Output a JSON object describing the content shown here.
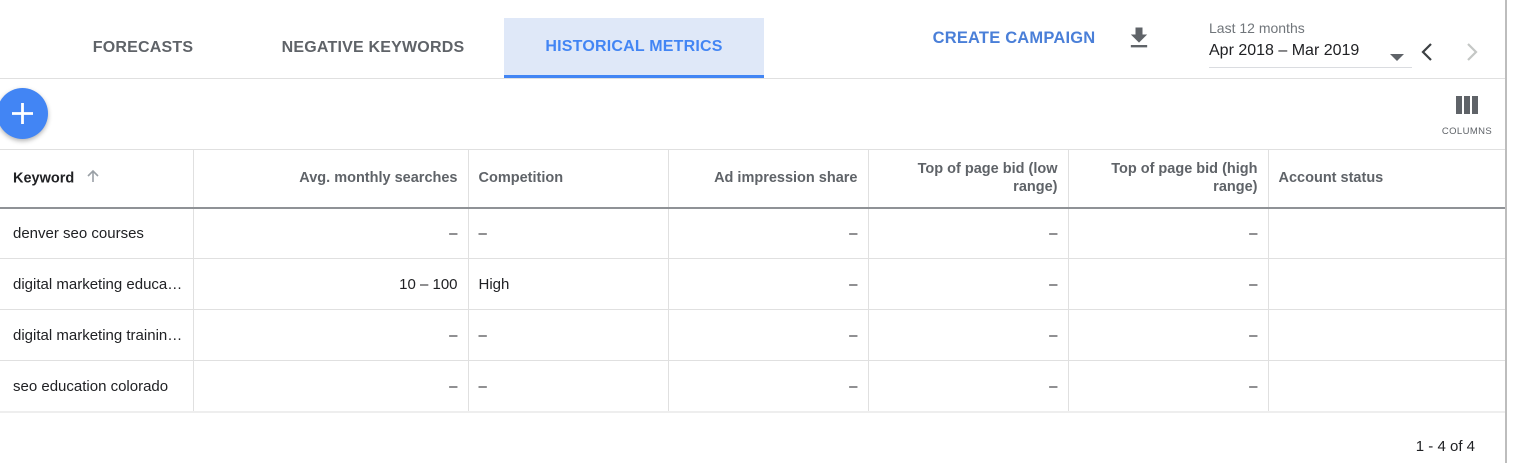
{
  "tabs": [
    {
      "label": "FORECASTS"
    },
    {
      "label": "NEGATIVE KEYWORDS"
    },
    {
      "label": "HISTORICAL METRICS",
      "active": true
    }
  ],
  "toolbar": {
    "create_campaign_label": "CREATE CAMPAIGN",
    "download_icon": "download-icon",
    "date_range_label": "Last 12 months",
    "date_range_value": "Apr 2018 – Mar 2019"
  },
  "actions": {
    "add_icon": "plus-icon",
    "columns_label": "COLUMNS"
  },
  "table": {
    "columns": [
      "Keyword",
      "Avg. monthly searches",
      "Competition",
      "Ad impression share",
      "Top of page bid (low range)",
      "Top of page bid (high range)",
      "Account status"
    ],
    "rows": [
      [
        "denver seo courses",
        "–",
        "–",
        "–",
        "–",
        "–",
        ""
      ],
      [
        "digital marketing educa…",
        "10 – 100",
        "High",
        "–",
        "–",
        "–",
        ""
      ],
      [
        "digital marketing trainin…",
        "–",
        "–",
        "–",
        "–",
        "–",
        ""
      ],
      [
        "seo education colorado",
        "–",
        "–",
        "–",
        "–",
        "–",
        ""
      ]
    ]
  },
  "pagination": {
    "text": "1 - 4 of 4"
  },
  "colors": {
    "accent": "#4285f4",
    "active_tab_bg": "#dfe8f8"
  }
}
